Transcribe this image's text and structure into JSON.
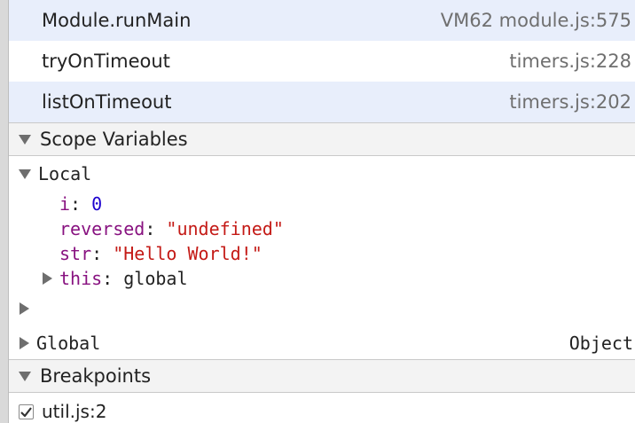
{
  "call_stack": [
    {
      "function": "Module.runMain",
      "location": "VM62 module.js:575",
      "selected": true
    },
    {
      "function": "tryOnTimeout",
      "location": "timers.js:228",
      "selected": false
    },
    {
      "function": "listOnTimeout",
      "location": "timers.js:202",
      "selected": true
    }
  ],
  "scope": {
    "header": "Scope Variables",
    "local_label": "Local",
    "vars": {
      "i_name": "i",
      "i_value": "0",
      "reversed_name": "reversed",
      "reversed_value": "\"undefined\"",
      "str_name": "str",
      "str_value": "\"Hello World!\"",
      "this_name": "this",
      "this_value": "global"
    },
    "global_label": "Global",
    "global_type": "Object"
  },
  "breakpoints": {
    "header": "Breakpoints",
    "items": [
      {
        "label": "util.js:2",
        "checked": true
      }
    ]
  },
  "colors": {
    "selected_row": "#e8eefb",
    "property_name": "#881280",
    "number_value": "#1c00cf",
    "string_value": "#c41a16"
  },
  "icons": [
    "expand-triangle-down-icon",
    "collapse-triangle-right-icon",
    "checkmark-icon"
  ]
}
